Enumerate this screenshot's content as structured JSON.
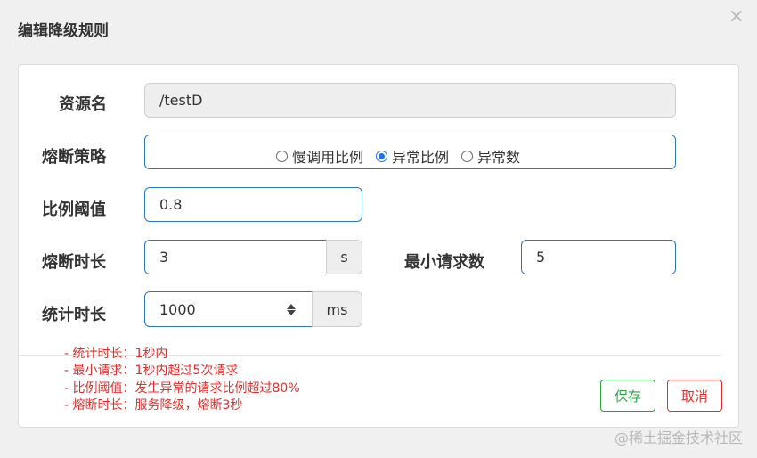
{
  "dialog": {
    "title": "编辑降级规则",
    "close_glyph": "×"
  },
  "form": {
    "resource": {
      "label": "资源名",
      "value": "/testD"
    },
    "strategy": {
      "label": "熔断策略",
      "options": [
        {
          "label": "慢调用比例",
          "checked": false
        },
        {
          "label": "异常比例",
          "checked": true
        },
        {
          "label": "异常数",
          "checked": false
        }
      ]
    },
    "ratio": {
      "label": "比例阈值",
      "value": "0.8"
    },
    "duration": {
      "label": "熔断时长",
      "value": "3",
      "unit": "s"
    },
    "min_requests": {
      "label": "最小请求数",
      "value": "5"
    },
    "stat_duration": {
      "label": "统计时长",
      "value": "1000",
      "unit": "ms"
    }
  },
  "notes": [
    "- 统计时长：1秒内",
    "- 最小请求：1秒内超过5次请求",
    "- 比例阈值：发生异常的请求比例超过80%",
    "- 熔断时长：服务降级，熔断3秒"
  ],
  "buttons": {
    "save": "保存",
    "cancel": "取消"
  },
  "watermark": "@稀土掘金技术社区",
  "colors": {
    "accent_border": "#2f76b5",
    "radio_checked": "#1a73e8",
    "save": "#2ea043",
    "danger": "#d9312f"
  }
}
